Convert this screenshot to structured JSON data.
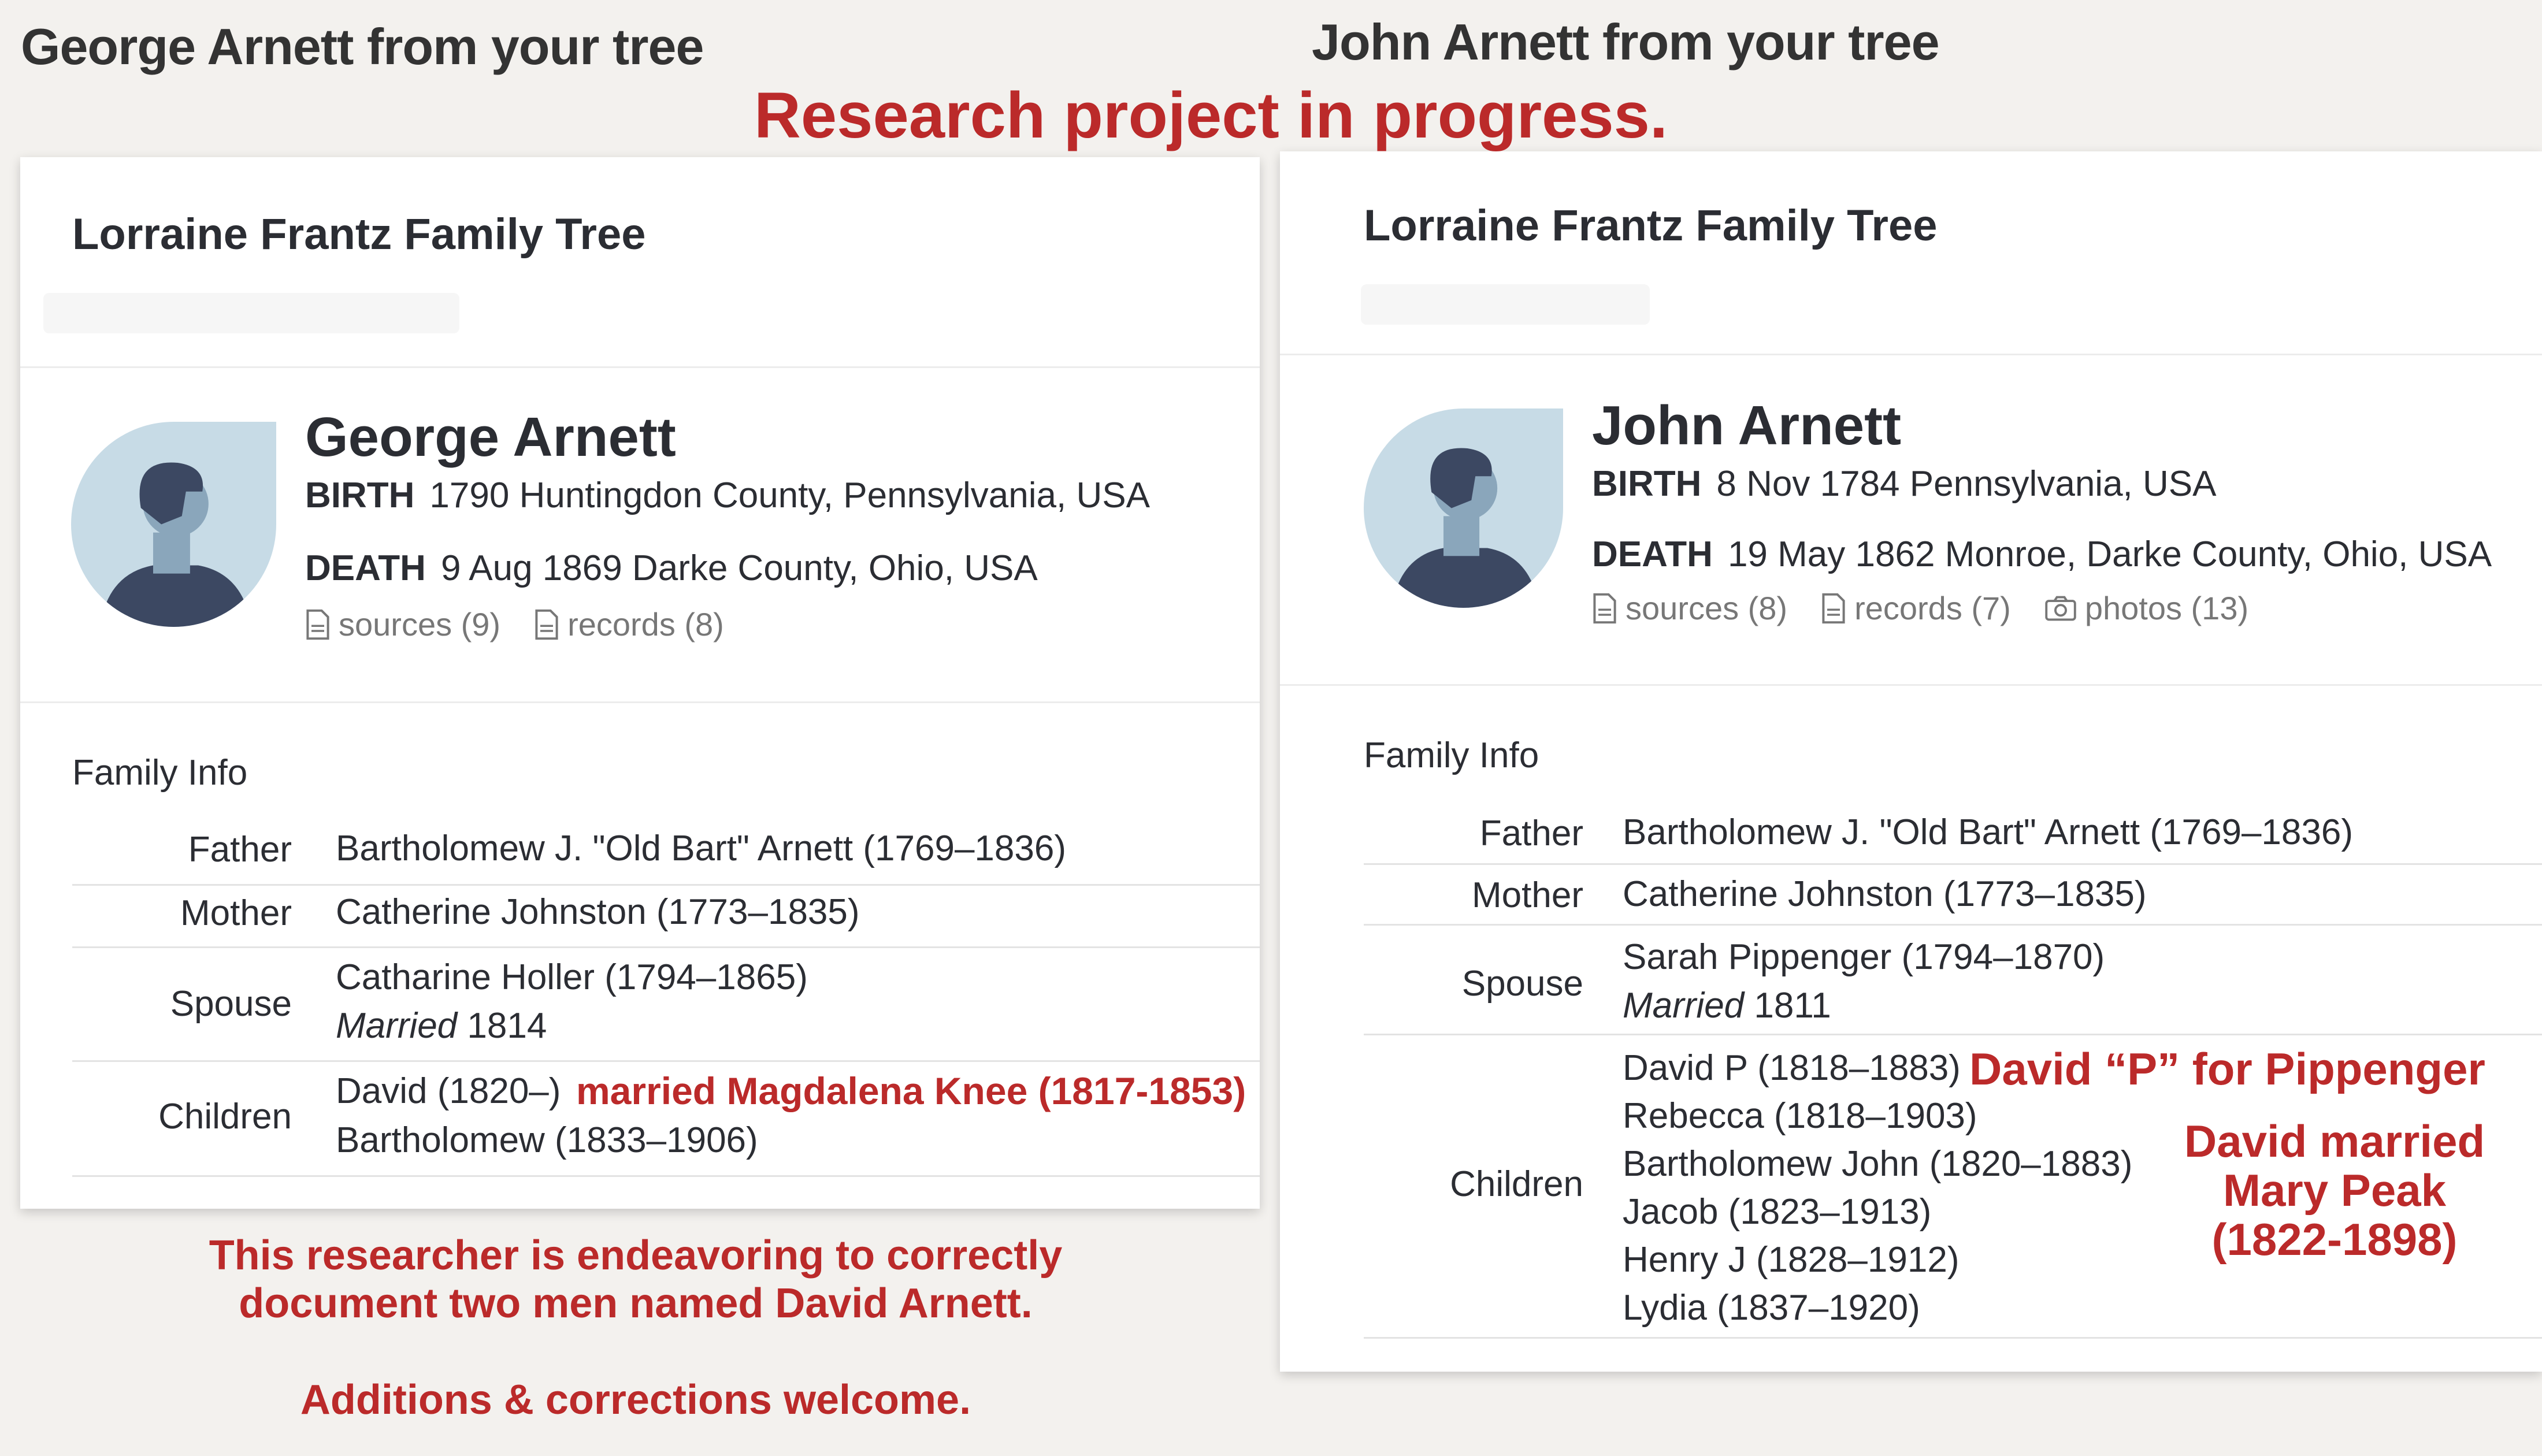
{
  "overlay": {
    "banner": "Research project in progress.",
    "note_line1": "This researcher is endeavoring to correctly",
    "note_line2": "document two men named David Arnett.",
    "note_line3": "Additions & corrections welcome.",
    "accent_color": "#bb2a2a"
  },
  "left": {
    "page_header": "George Arnett from your tree",
    "tree_title": "Lorraine Frantz Family Tree",
    "person": {
      "name": "George Arnett",
      "birth_label": "BIRTH",
      "birth_value": "1790 Huntingdon County, Pennsylvania, USA",
      "death_label": "DEATH",
      "death_value": "9 Aug 1869 Darke County, Ohio, USA",
      "sources": "sources (9)",
      "records": "records (8)",
      "avatar_icon": "person-silhouette-icon"
    },
    "family": {
      "section_label": "Family Info",
      "father_label": "Father",
      "father": "Bartholomew J. \"Old Bart\" Arnett (1769–1836)",
      "mother_label": "Mother",
      "mother": "Catherine Johnston (1773–1835)",
      "spouse_label": "Spouse",
      "spouse": "Catharine Holler (1794–1865)",
      "married_word": "Married",
      "married_year": "1814",
      "children_label": "Children",
      "children": [
        "David (1820–)",
        "Bartholomew (1833–1906)"
      ],
      "child_note": "married Magdalena Knee (1817-1853)"
    }
  },
  "right": {
    "page_header": "John Arnett from your tree",
    "tree_title": "Lorraine Frantz Family Tree",
    "person": {
      "name": "John Arnett",
      "birth_label": "BIRTH",
      "birth_value": "8 Nov 1784 Pennsylvania, USA",
      "death_label": "DEATH",
      "death_value": "19 May 1862 Monroe, Darke County, Ohio, USA",
      "sources": "sources (8)",
      "records": "records (7)",
      "photos": "photos (13)",
      "avatar_icon": "person-silhouette-icon"
    },
    "family": {
      "section_label": "Family Info",
      "father_label": "Father",
      "father": "Bartholomew J. \"Old Bart\" Arnett (1769–1836)",
      "mother_label": "Mother",
      "mother": "Catherine Johnston (1773–1835)",
      "spouse_label": "Spouse",
      "spouse": "Sarah Pippenger (1794–1870)",
      "married_word": "Married",
      "married_year": "1811",
      "children_label": "Children",
      "children": [
        "David P (1818–1883)",
        "Rebecca (1818–1903)",
        "Bartholomew John (1820–1883)",
        "Jacob (1823–1913)",
        "Henry J (1828–1912)",
        "Lydia (1837–1920)"
      ],
      "note_david_p": "David “P” for Pippenger",
      "note_married_1": "David married",
      "note_married_2": "Mary Peak",
      "note_married_3": "(1822-1898)"
    }
  }
}
